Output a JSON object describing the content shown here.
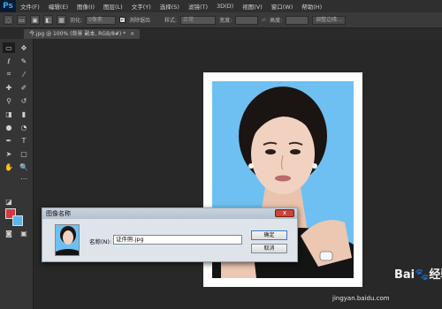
{
  "app": {
    "logo": "Ps"
  },
  "menu": [
    "文件(F)",
    "编辑(E)",
    "图像(I)",
    "图层(L)",
    "文字(Y)",
    "选择(S)",
    "滤镜(T)",
    "3D(D)",
    "视图(V)",
    "窗口(W)",
    "帮助(H)"
  ],
  "options": {
    "feather_label": "羽化:",
    "feather_value": "0像素",
    "antialias_label": "消除锯齿",
    "style_label": "样式:",
    "style_value": "正常",
    "width_label": "宽度:",
    "height_label": "高度:",
    "refine_edge": "调整边缘..."
  },
  "tab": {
    "title": "今.jpg @ 100% (背景 副本, RGB/8#) *",
    "close": "×"
  },
  "colors": {
    "foreground": "#d23a3f",
    "background": "#5bb6f0"
  },
  "dialog": {
    "title": "图像名称",
    "close": "x",
    "name_label": "名称(N):",
    "name_value": "证件照.jpg",
    "ok": "确定",
    "cancel": "取消"
  },
  "watermark": {
    "brand": "Bai🐾经验",
    "url": "jingyan.baidu.com"
  }
}
